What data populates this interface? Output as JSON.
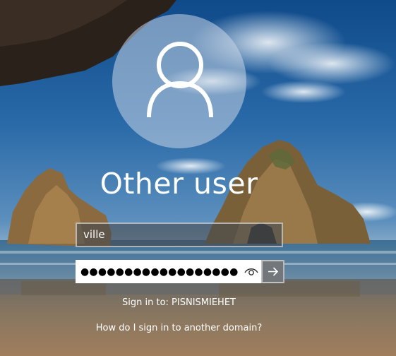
{
  "user": {
    "display_name": "Other user"
  },
  "login": {
    "username_value": "ville",
    "password_mask": "●●●●●●●●●●●●●●●●●●●"
  },
  "sign_in_to": "Sign in to: PISNISMIEHET",
  "domain_link": "How do I sign in to another domain?",
  "icons": {
    "avatar": "user-silhouette-icon",
    "reveal": "eye-icon",
    "submit": "arrow-right-icon"
  },
  "colors": {
    "text": "#ffffff",
    "field_bg": "#ffffff",
    "submit_bg": "#5a5e64"
  }
}
